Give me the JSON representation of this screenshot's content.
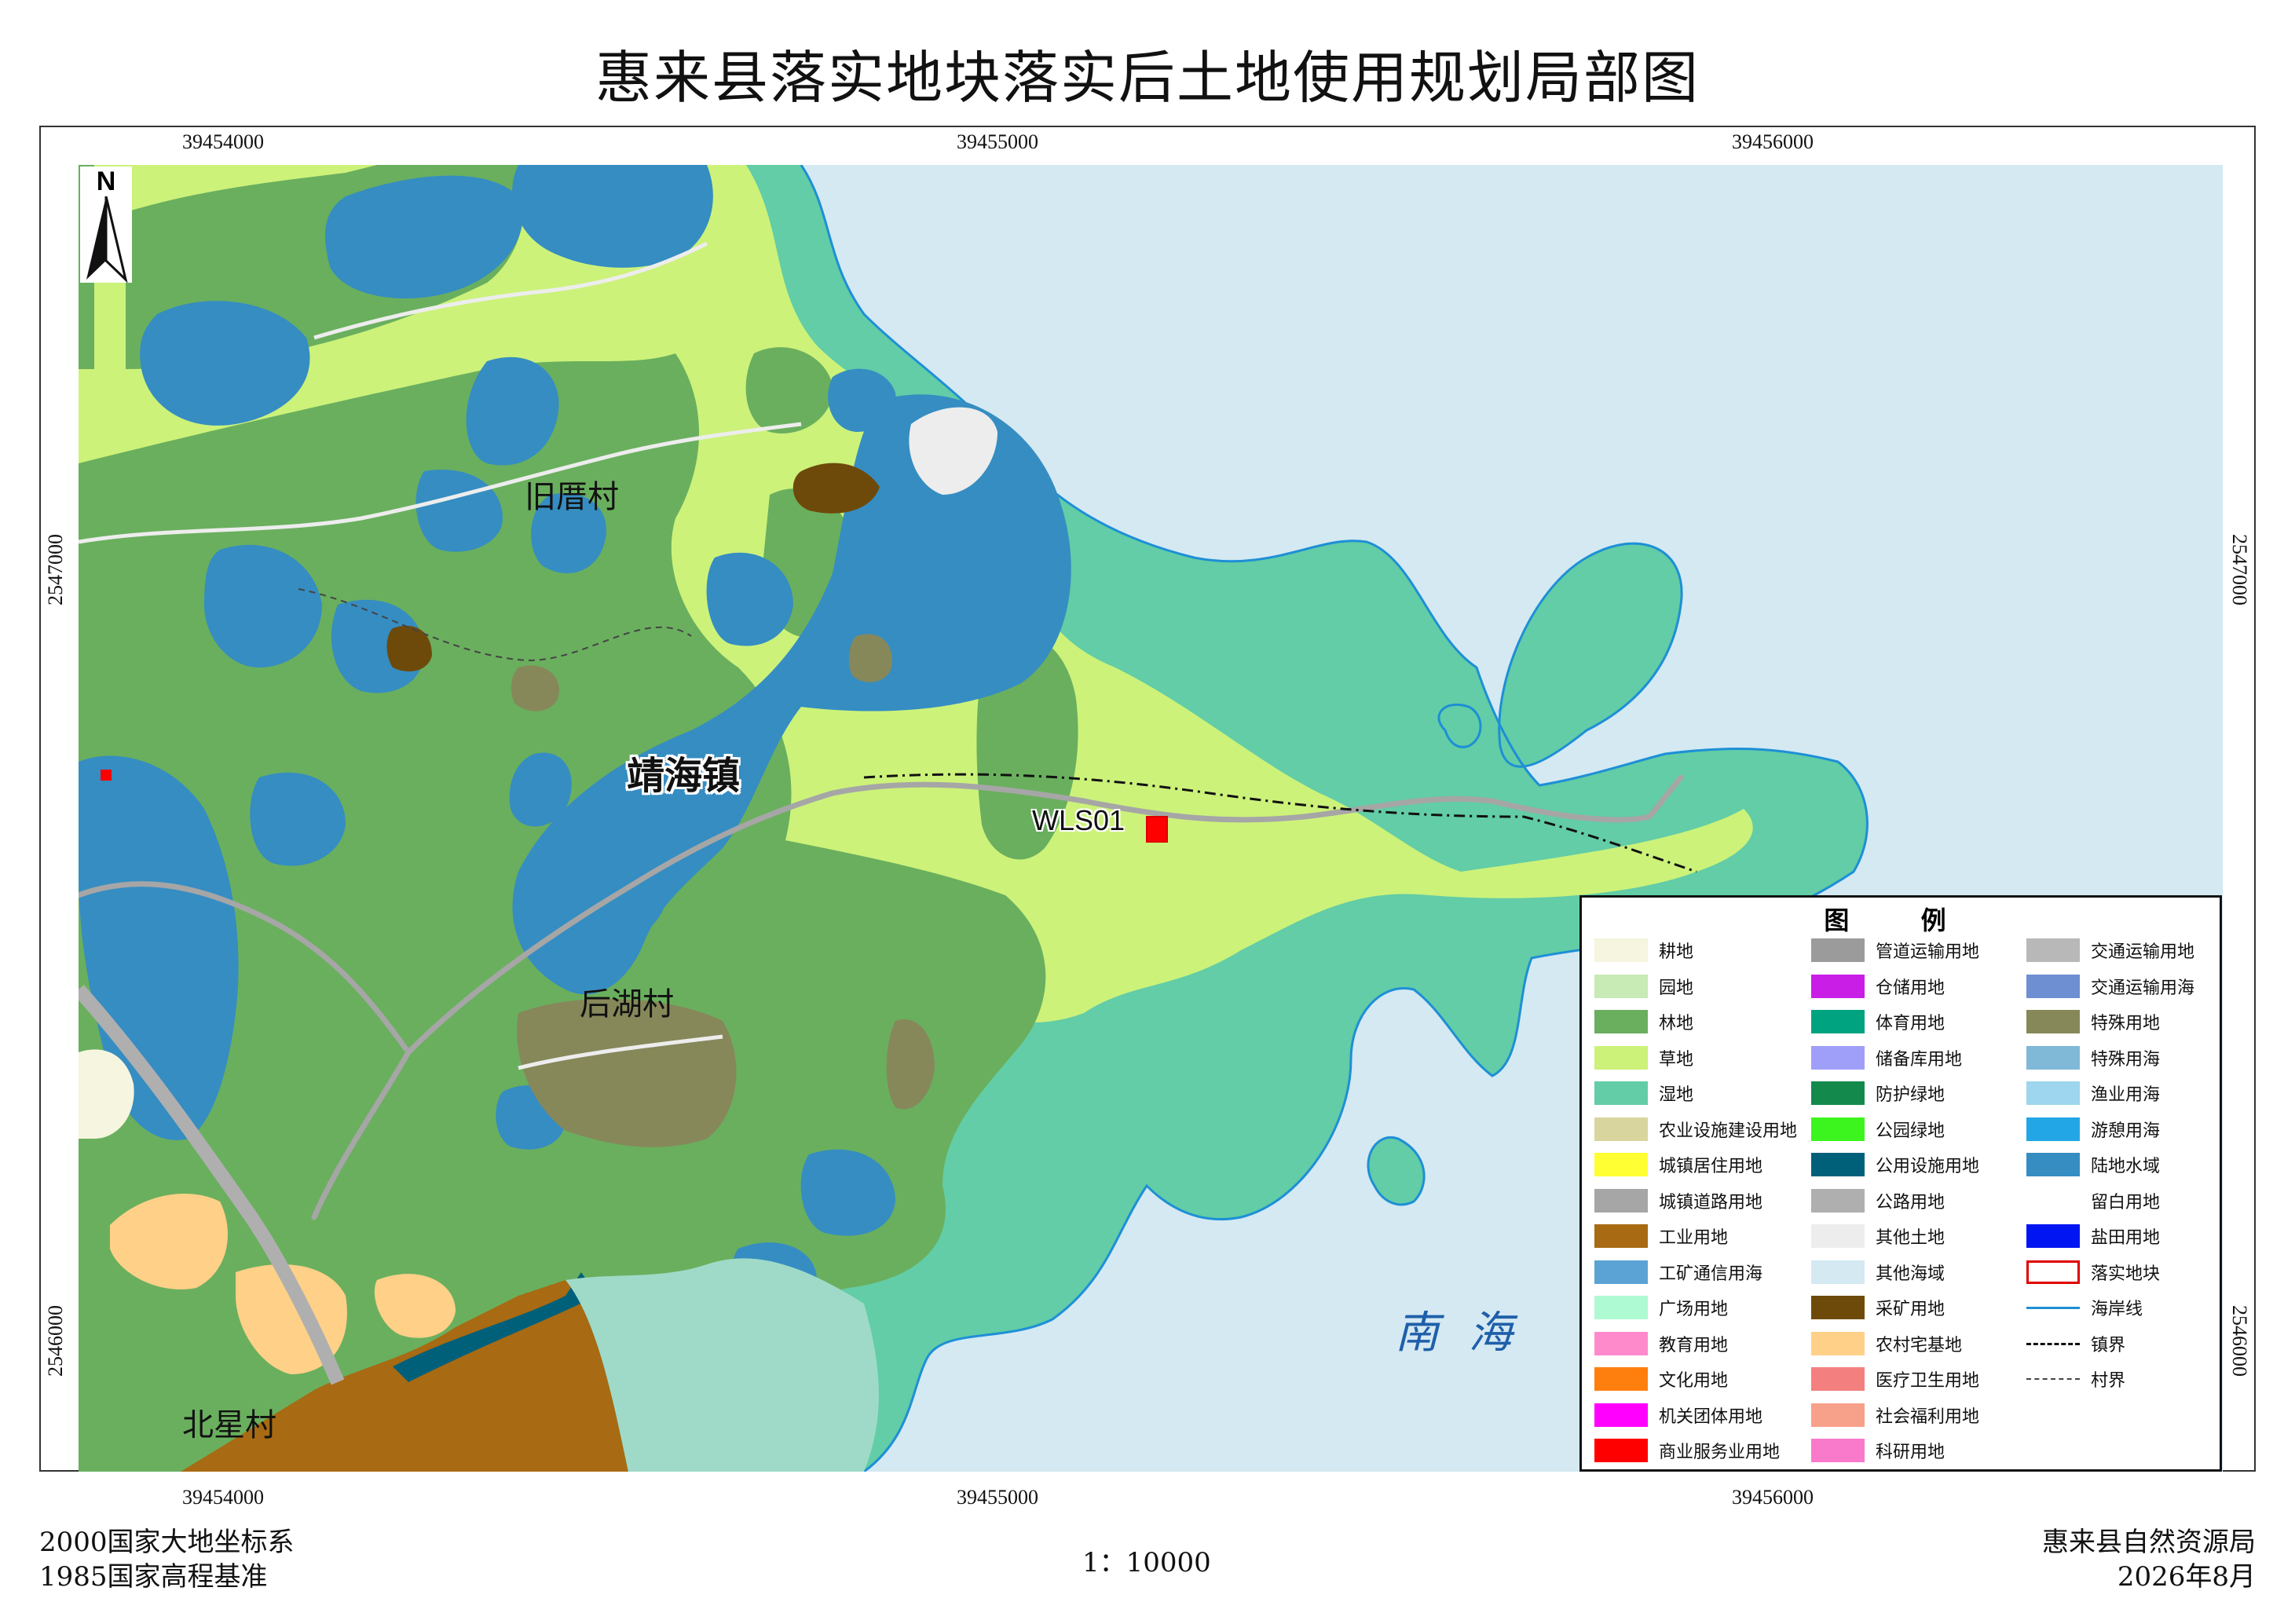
{
  "title": "惠来县落实地块落实后土地使用规划局部图",
  "coords": {
    "x": [
      "39454000",
      "39455000",
      "39456000"
    ],
    "y": [
      "2547000",
      "2546000"
    ]
  },
  "north": "N",
  "places": {
    "jiucun": "旧厝村",
    "jinghai": "靖海镇",
    "houhu": "后湖村",
    "beixing": "北星村",
    "sea": "南 海",
    "parcel": "WLS01"
  },
  "legend": {
    "title": "图 例",
    "items": [
      {
        "label": "耕地",
        "color": "#F5F5E0",
        "kind": "fill"
      },
      {
        "label": "园地",
        "color": "#C8EAB4",
        "kind": "fill"
      },
      {
        "label": "林地",
        "color": "#6AAF5E",
        "kind": "fill"
      },
      {
        "label": "草地",
        "color": "#CCF27A",
        "kind": "fill"
      },
      {
        "label": "湿地",
        "color": "#62CDA6",
        "kind": "fill"
      },
      {
        "label": "农业设施建设用地",
        "color": "#D9D59E",
        "kind": "fill"
      },
      {
        "label": "城镇居住用地",
        "color": "#FFFF33",
        "kind": "fill"
      },
      {
        "label": "城镇道路用地",
        "color": "#A6A6A6",
        "kind": "fill"
      },
      {
        "label": "工业用地",
        "color": "#A86A12",
        "kind": "fill"
      },
      {
        "label": "工矿通信用海",
        "color": "#5AA3D4",
        "kind": "fill"
      },
      {
        "label": "广场用地",
        "color": "#AEFAD2",
        "kind": "fill"
      },
      {
        "label": "教育用地",
        "color": "#FF8ACB",
        "kind": "fill"
      },
      {
        "label": "文化用地",
        "color": "#FF7F0E",
        "kind": "fill"
      },
      {
        "label": "机关团体用地",
        "color": "#FF00FF",
        "kind": "fill"
      },
      {
        "label": "商业服务业用地",
        "color": "#FF0000",
        "kind": "fill"
      },
      {
        "label": "管道运输用地",
        "color": "#9B9B9B",
        "kind": "fill"
      },
      {
        "label": "仓储用地",
        "color": "#C81EE6",
        "kind": "fill"
      },
      {
        "label": "体育用地",
        "color": "#00A37F",
        "kind": "fill"
      },
      {
        "label": "储备库用地",
        "color": "#9F9FFA",
        "kind": "fill"
      },
      {
        "label": "防护绿地",
        "color": "#138A4C",
        "kind": "fill"
      },
      {
        "label": "公园绿地",
        "color": "#3DF51E",
        "kind": "fill"
      },
      {
        "label": "公用设施用地",
        "color": "#00607A",
        "kind": "fill"
      },
      {
        "label": "公路用地",
        "color": "#AFAFAF",
        "kind": "fill"
      },
      {
        "label": "其他土地",
        "color": "#EDEDED",
        "kind": "fill"
      },
      {
        "label": "其他海域",
        "color": "#D4E9F2",
        "kind": "fill"
      },
      {
        "label": "采矿用地",
        "color": "#6E4A0A",
        "kind": "fill"
      },
      {
        "label": "农村宅基地",
        "color": "#FFD088",
        "kind": "fill"
      },
      {
        "label": "医疗卫生用地",
        "color": "#F47F7F",
        "kind": "fill"
      },
      {
        "label": "社会福利用地",
        "color": "#F7A08A",
        "kind": "fill"
      },
      {
        "label": "科研用地",
        "color": "#F97ACB",
        "kind": "fill"
      },
      {
        "label": "交通运输用地",
        "color": "#B8B8B8",
        "kind": "fill"
      },
      {
        "label": "交通运输用海",
        "color": "#6E8FD1",
        "kind": "fill"
      },
      {
        "label": "特殊用地",
        "color": "#86885A",
        "kind": "fill"
      },
      {
        "label": "特殊用海",
        "color": "#80B8D8",
        "kind": "fill"
      },
      {
        "label": "渔业用海",
        "color": "#9DD6EE",
        "kind": "fill"
      },
      {
        "label": "游憩用海",
        "color": "#22A6E6",
        "kind": "fill"
      },
      {
        "label": "陆地水域",
        "color": "#358DC2",
        "kind": "fill"
      },
      {
        "label": "留白用地",
        "color": "#FFFFFF",
        "kind": "fill"
      },
      {
        "label": "盐田用地",
        "color": "#0015F2",
        "kind": "fill"
      },
      {
        "label": "落实地块",
        "color": "#E00000",
        "kind": "outline"
      },
      {
        "label": "海岸线",
        "color": "#1E8FD6",
        "kind": "line"
      },
      {
        "label": "镇界",
        "color": "#111111",
        "kind": "dashdot"
      },
      {
        "label": "村界",
        "color": "#444444",
        "kind": "dash"
      }
    ]
  },
  "footer": {
    "crs": "2000国家大地坐标系",
    "height": "1985国家高程基准",
    "scale": "1：10000",
    "agency": "惠来县自然资源局",
    "date": "2026年8月"
  }
}
